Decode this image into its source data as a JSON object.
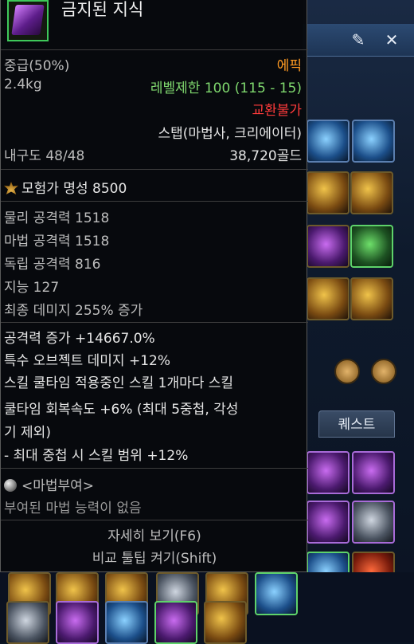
{
  "background": {
    "quest_tab": "퀘스트",
    "pin_icon": "pin-icon",
    "close_icon": "close-icon"
  },
  "tooltip": {
    "item_name": "금지된 지식",
    "subtitle": "",
    "grade": "중급(50%)",
    "rarity": "에픽",
    "weight": "2.4kg",
    "level_limit": "레벨제한 100 (115 - 15)",
    "trade": "교환불가",
    "stab_class": "스탭(마법사, 크리에이터)",
    "durability": "내구도 48/48",
    "price": "38,720골드",
    "fame": "모험가 명성 8500",
    "stats": [
      "물리 공격력 1518",
      "마법 공격력 1518",
      "독립 공격력 816",
      "지능 127",
      "최종 데미지 255% 증가"
    ],
    "options": [
      "공격력 증가 +14667.0%",
      "특수 오브젝트 데미지 +12%",
      "스킬 쿨타임 적용중인 스킬 1개마다 스킬",
      "쿨타임 회복속도 +6% (최대 5중첩, 각성",
      "기 제외)",
      "- 최대 중첩 시 스킬 범위 +12%"
    ],
    "enchant_title": "<마법부여>",
    "enchant_desc": "부여된 마법 능력이 없음",
    "detail_view": "자세히 보기(F6)",
    "compare_tooltip": "비교 툴팁 켜기(Shift)"
  }
}
